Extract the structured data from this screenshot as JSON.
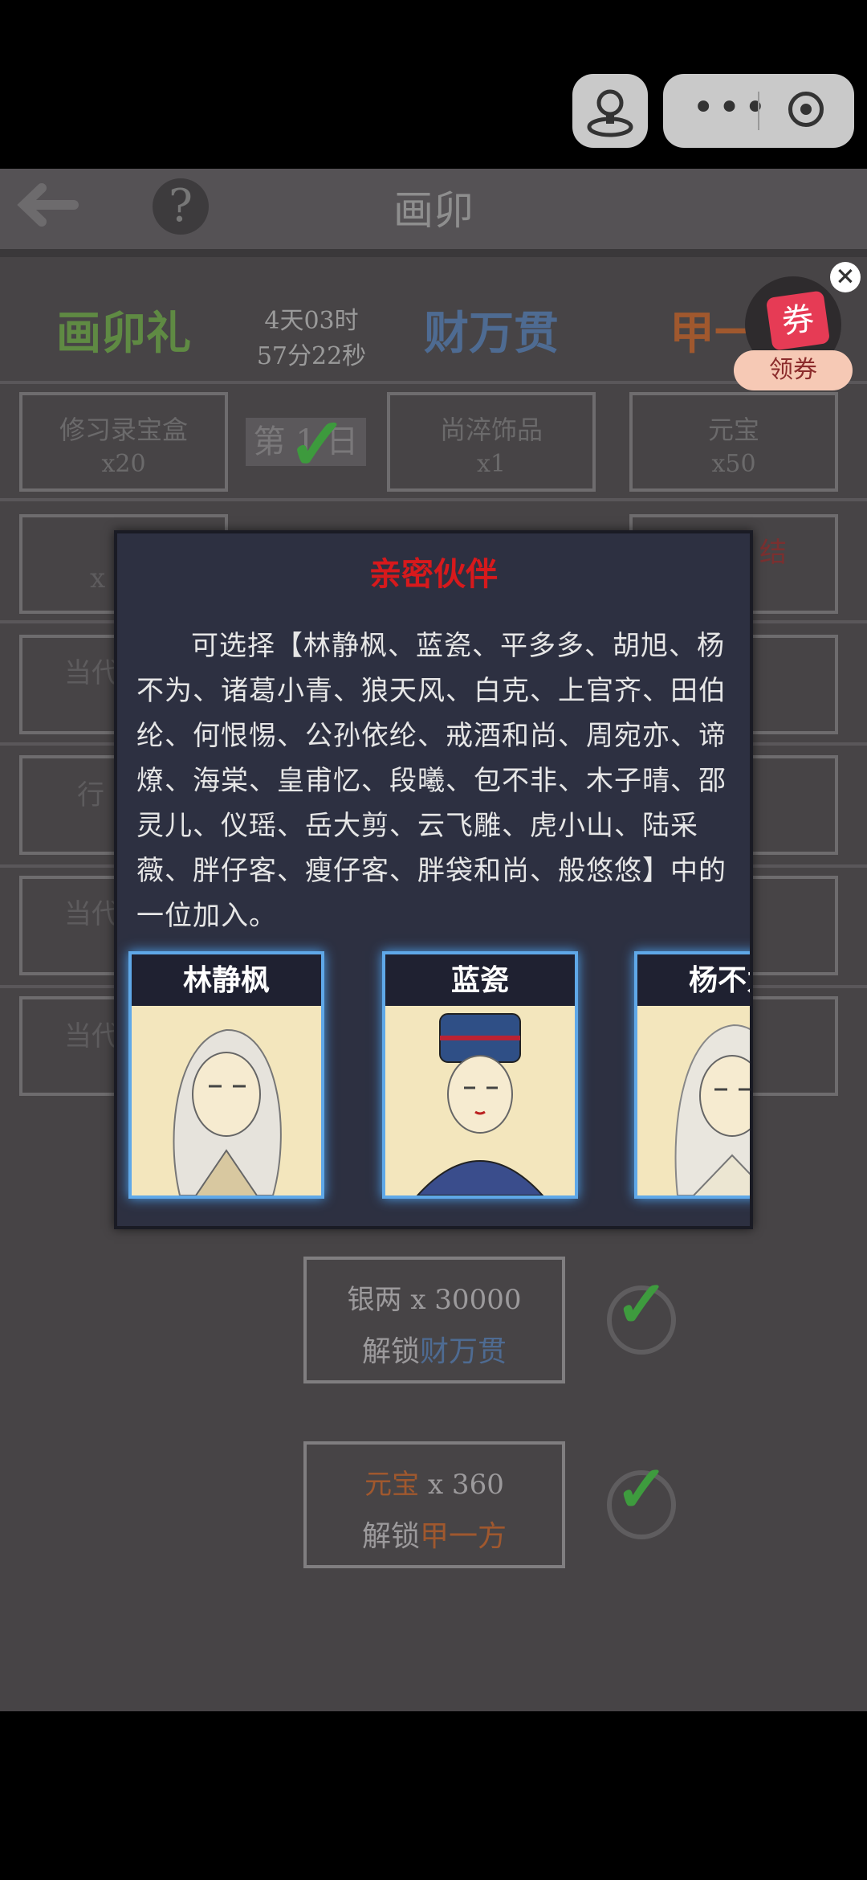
{
  "header": {
    "title": "画卯"
  },
  "tabs": [
    {
      "label": "画卯礼"
    },
    {
      "label": "财万贯"
    },
    {
      "label": "甲一"
    }
  ],
  "timer": {
    "line1": "4天03时",
    "line2": "57分22秒"
  },
  "day": {
    "label": "第 1 日"
  },
  "rewards_row1": [
    {
      "name": "修习录宝盒",
      "qty": "x20"
    },
    {
      "name": "尚淬饰品",
      "qty": "x1"
    },
    {
      "name": "元宝",
      "qty": "x50"
    }
  ],
  "background_fragments": {
    "r2_left": "x",
    "r2_right": "结",
    "r3": "当代",
    "r4": "行",
    "r5": "当代",
    "r6": "当代"
  },
  "unlocks": [
    {
      "cost": "银两 x 30000",
      "prefix": "解锁",
      "target": "财万贯"
    },
    {
      "cost_label": "元宝",
      "cost_qty": "x 360",
      "prefix": "解锁",
      "target": "甲一方"
    }
  ],
  "coupon": {
    "icon_text": "券",
    "label": "领券"
  },
  "modal": {
    "title": "亲密伙伴",
    "text": "可选择【林静枫、蓝瓷、平多多、胡旭、杨不为、诸葛小青、狼天风、白克、上官齐、田伯纶、何恨惕、公孙依纶、戒酒和尚、周宛亦、谛燎、海棠、皇甫忆、段曦、包不非、木子晴、邵灵儿、仪瑶、岳大剪、云飞雕、虎小山、陆采薇、胖仔客、瘦仔客、胖袋和尚、般悠悠】中的一位加入。",
    "cards": [
      {
        "name": "林静枫"
      },
      {
        "name": "蓝瓷"
      },
      {
        "name": "杨不为"
      }
    ]
  },
  "colors": {
    "accent_green": "#5f8a43",
    "accent_blue": "#4e6b92",
    "accent_orange": "#a0582e",
    "modal_title_red": "#d7191c"
  }
}
